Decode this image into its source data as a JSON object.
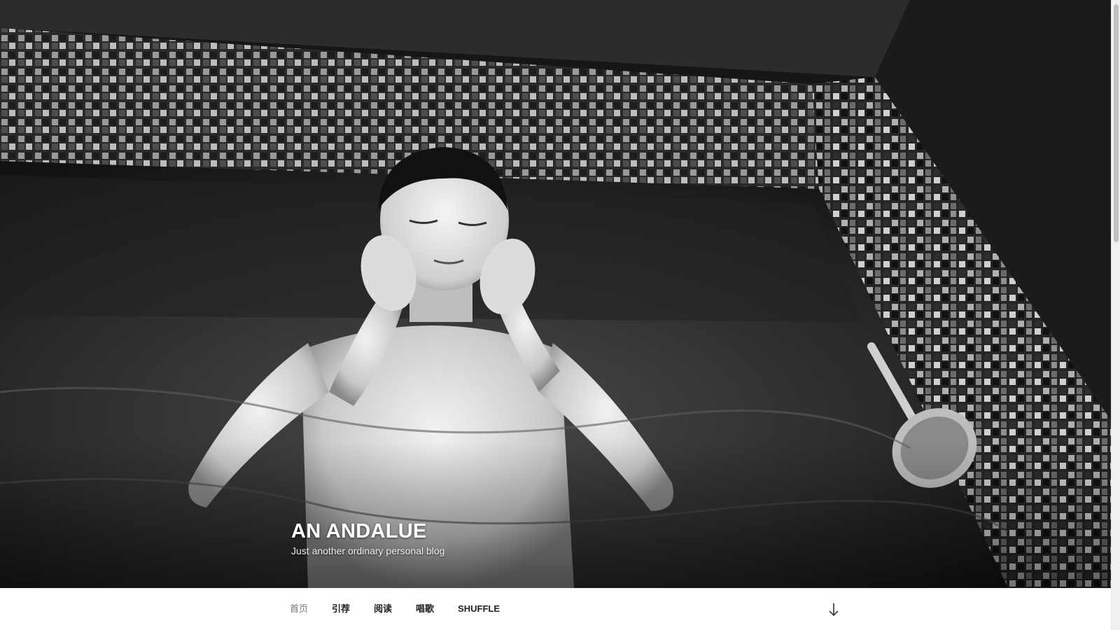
{
  "site": {
    "title": "AN ANDALUE",
    "description": "Just another ordinary personal blog"
  },
  "hero": {
    "image_subject": "black-and-white photo of a man relaxing in a tiled hot tub"
  },
  "nav": {
    "items": [
      {
        "label": "首页",
        "current": true
      },
      {
        "label": "引荐",
        "current": false
      },
      {
        "label": "阅读",
        "current": false
      },
      {
        "label": "唱歌",
        "current": false
      },
      {
        "label": "SHUFFLE",
        "current": false
      }
    ],
    "scroll_icon": "arrow-down-icon"
  }
}
